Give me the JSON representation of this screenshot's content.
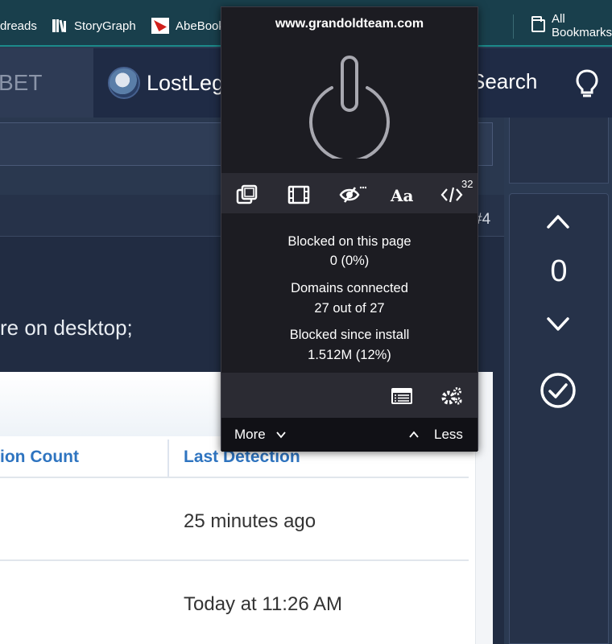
{
  "bookmarks": {
    "items": [
      {
        "label": "dreads"
      },
      {
        "label": "StoryGraph"
      },
      {
        "label": "AbeBooks"
      }
    ],
    "all_label": "All Bookmarks"
  },
  "site_nav": {
    "left_label": "BET",
    "user_name": "LostLeg",
    "search_label": "Search"
  },
  "post": {
    "number": "#4",
    "text": "re on desktop;",
    "table": {
      "headers": [
        "ion Count",
        "Last Detection"
      ],
      "rows": [
        "25 minutes ago",
        "Today at 11:26 AM"
      ]
    }
  },
  "votes": {
    "count": "0"
  },
  "popup": {
    "hostname": "www.grandoldteam.com",
    "js_count": "32",
    "font_tool_label": "Aa",
    "stats": [
      {
        "label": "Blocked on this page",
        "value": "0 (0%)"
      },
      {
        "label": "Domains connected",
        "value": "27 out of 27"
      },
      {
        "label": "Blocked since install",
        "value": "1.512M (12%)"
      }
    ],
    "more_label": "More",
    "less_label": "Less"
  },
  "icons": {
    "power": "power-icon",
    "popups": "no-popups-icon",
    "media": "no-large-media-icon",
    "cosmetic": "no-cosmetic-filtering-icon",
    "fonts": "no-remote-fonts-icon",
    "js": "no-scripting-icon",
    "logger": "logger-icon",
    "dashboard": "dashboard-icon"
  },
  "colors": {
    "popup_bg": "#1c1c22",
    "popup_toolbar": "#2b2b33",
    "bookmarks_bg": "#193f4c",
    "site_nav_bg": "#1f2b45",
    "table_header": "#2e74c0"
  }
}
